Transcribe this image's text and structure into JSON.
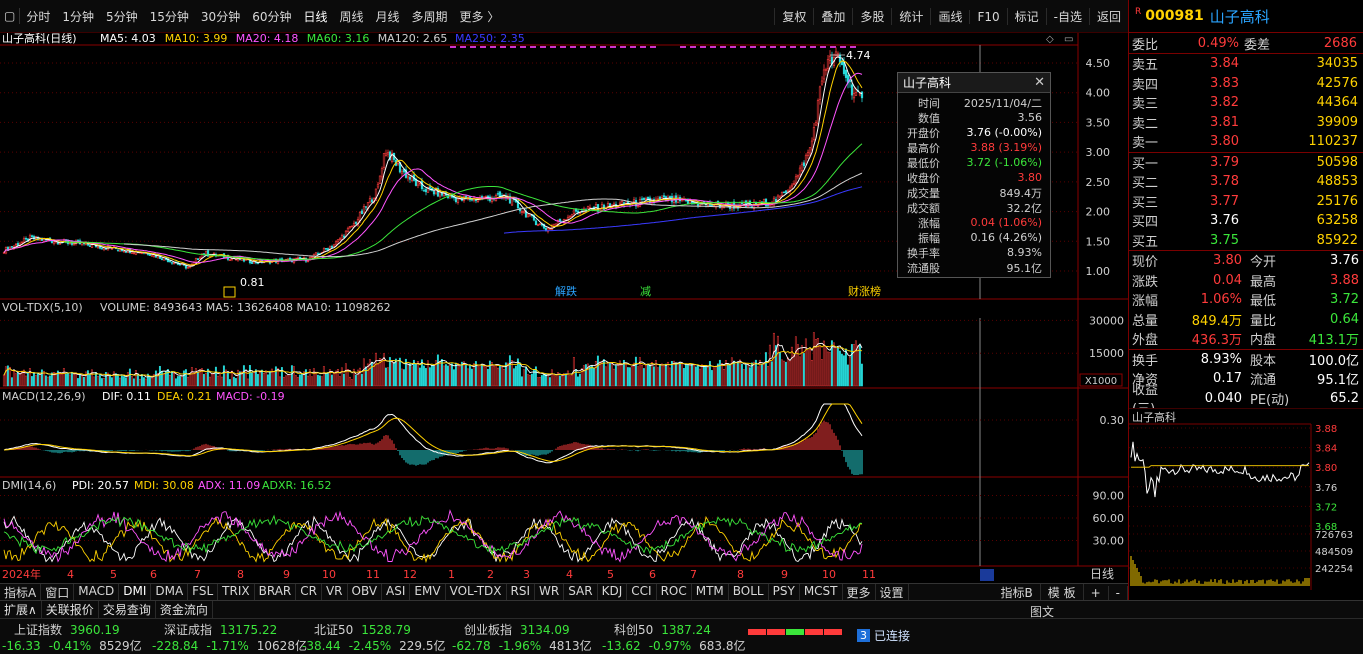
{
  "topbar": {
    "periods": [
      "分时",
      "1分钟",
      "5分钟",
      "15分钟",
      "30分钟",
      "60分钟",
      "日线",
      "周线",
      "月线",
      "多周期",
      "更多 〉"
    ],
    "active": "日线",
    "right": [
      "复权",
      "叠加",
      "多股",
      "统计",
      "画线",
      "F10",
      "标记",
      "-自选",
      "返回"
    ]
  },
  "main_chart": {
    "name": "山子高科(日线)",
    "ma": [
      {
        "label": "MA5: 4.03",
        "color": "#ffffff"
      },
      {
        "label": "MA10: 3.99",
        "color": "#ffd200"
      },
      {
        "label": "MA20: 4.18",
        "color": "#ff55ff"
      },
      {
        "label": "MA60: 3.16",
        "color": "#3be63b"
      },
      {
        "label": "MA120: 2.65",
        "color": "#d0d0d0"
      },
      {
        "label": "MA250: 2.35",
        "color": "#3a3aff"
      }
    ],
    "y_ticks": [
      "4.50",
      "4.00",
      "3.50",
      "3.00",
      "2.50",
      "2.00",
      "1.50",
      "1.00"
    ],
    "high_label": "4.74",
    "low_label": "0.81",
    "markers": [
      "解跌",
      "减",
      "财涨榜"
    ],
    "colors": {
      "up": "#ff3b3b",
      "down": "#26d9d9"
    }
  },
  "vol_panel": {
    "title": "VOL-TDX(5,10)",
    "values": "VOLUME: 8493643  MA5: 13626408  MA10: 11098262",
    "y_ticks": [
      "30000",
      "15000"
    ],
    "unit": "X1000"
  },
  "macd_panel": {
    "title": "MACD(12,26,9)",
    "dif": "DIF: 0.11",
    "dea": "DEA: 0.21",
    "macd": "MACD: -0.19",
    "y_ticks": [
      "0.30"
    ]
  },
  "dmi_panel": {
    "title": "DMI(14,6)",
    "pdi": "PDI: 20.57",
    "mdi": "MDI: 30.08",
    "adx": "ADX: 11.09",
    "adxr": "ADXR: 16.52",
    "y_ticks": [
      "90.00",
      "60.00",
      "30.00"
    ]
  },
  "x_axis": {
    "labels": [
      "2024年",
      "4",
      "5",
      "6",
      "7",
      "8",
      "9",
      "10",
      "11",
      "12",
      "1",
      "2",
      "3",
      "4",
      "5",
      "6",
      "7",
      "8",
      "9",
      "10",
      "11"
    ],
    "period_label": "日线"
  },
  "popup": {
    "title": "山子高科",
    "close": "✕",
    "rows": [
      {
        "k": "时间",
        "v": "2025/11/04/二",
        "c": "#d0d0d0"
      },
      {
        "k": "数值",
        "v": "3.56",
        "c": "#d0d0d0"
      },
      {
        "k": "开盘价",
        "v": "3.76 (-0.00%)",
        "c": "#ffffff"
      },
      {
        "k": "最高价",
        "v": "3.88 (3.19%)",
        "c": "#ff3b3b"
      },
      {
        "k": "最低价",
        "v": "3.72 (-1.06%)",
        "c": "#3be63b"
      },
      {
        "k": "收盘价",
        "v": "3.80",
        "c": "#ff3b3b"
      },
      {
        "k": "成交量",
        "v": "849.4万",
        "c": "#d0d0d0"
      },
      {
        "k": "成交额",
        "v": "32.2亿",
        "c": "#d0d0d0"
      },
      {
        "k": "涨幅",
        "v": "0.04 (1.06%)",
        "c": "#ff3b3b"
      },
      {
        "k": "振幅",
        "v": "0.16 (4.26%)",
        "c": "#d0d0d0"
      },
      {
        "k": "换手率",
        "v": "8.93%",
        "c": "#d0d0d0"
      },
      {
        "k": "流通股",
        "v": "95.1亿",
        "c": "#d0d0d0"
      }
    ]
  },
  "quote": {
    "r_flag": "R",
    "code": "000981",
    "name": "山子高科",
    "weibi_label": "委比",
    "weibi": "0.49%",
    "weicha_label": "委差",
    "weicha": "2686",
    "sells": [
      {
        "l": "卖五",
        "p": "3.84",
        "v": "34035"
      },
      {
        "l": "卖四",
        "p": "3.83",
        "v": "42576"
      },
      {
        "l": "卖三",
        "p": "3.82",
        "v": "44364"
      },
      {
        "l": "卖二",
        "p": "3.81",
        "v": "39909"
      },
      {
        "l": "卖一",
        "p": "3.80",
        "v": "110237"
      }
    ],
    "buys": [
      {
        "l": "买一",
        "p": "3.79",
        "v": "50598",
        "pc": "red"
      },
      {
        "l": "买二",
        "p": "3.78",
        "v": "48853",
        "pc": "red"
      },
      {
        "l": "买三",
        "p": "3.77",
        "v": "25176",
        "pc": "red"
      },
      {
        "l": "买四",
        "p": "3.76",
        "v": "63258",
        "pc": "wht"
      },
      {
        "l": "买五",
        "p": "3.75",
        "v": "85922",
        "pc": "grn"
      }
    ],
    "stats": [
      {
        "a": "现价",
        "b": "3.80",
        "bc": "red",
        "c": "今开",
        "d": "3.76",
        "dc": "wht"
      },
      {
        "a": "涨跌",
        "b": "0.04",
        "bc": "red",
        "c": "最高",
        "d": "3.88",
        "dc": "red"
      },
      {
        "a": "涨幅",
        "b": "1.06%",
        "bc": "red",
        "c": "最低",
        "d": "3.72",
        "dc": "grn"
      },
      {
        "a": "总量",
        "b": "849.4万",
        "bc": "yel",
        "c": "量比",
        "d": "0.64",
        "dc": "grn"
      },
      {
        "a": "外盘",
        "b": "436.3万",
        "bc": "red",
        "c": "内盘",
        "d": "413.1万",
        "dc": "grn"
      }
    ],
    "stats2": [
      {
        "a": "换手",
        "b": "8.93%",
        "c": "股本",
        "d": "100.0亿"
      },
      {
        "a": "净资",
        "b": "0.17",
        "c": "流通",
        "d": "95.1亿"
      },
      {
        "a": "收益(三)",
        "b": "0.040",
        "c": "PE(动)",
        "d": "65.2"
      }
    ],
    "mini_title": "山子高科",
    "mini_ticks": [
      "3.88",
      "3.84",
      "3.80",
      "3.76",
      "3.72",
      "3.68"
    ],
    "mini_vol_ticks": [
      "726763",
      "484509",
      "242254"
    ]
  },
  "tabs": {
    "items": [
      "指标A",
      "窗口",
      "MACD",
      "DMI",
      "DMA",
      "FSL",
      "TRIX",
      "BRAR",
      "CR",
      "VR",
      "OBV",
      "ASI",
      "EMV",
      "VOL-TDX",
      "RSI",
      "WR",
      "SAR",
      "KDJ",
      "CCI",
      "ROC",
      "MTM",
      "BOLL",
      "PSY",
      "MCST",
      "更多",
      "设置"
    ],
    "active": "DMI",
    "right": [
      "指标B",
      "模 板",
      "+",
      "-"
    ]
  },
  "tools": [
    "扩展∧",
    "关联报价",
    "交易查询",
    "资金流向"
  ],
  "status": {
    "indices": [
      {
        "name": "上证指数",
        "val": "3960.19",
        "chg": "-16.33",
        "pct": "-0.41%",
        "amt": "8529亿"
      },
      {
        "name": "深证成指",
        "val": "13175.22",
        "chg": "-228.84",
        "pct": "-1.71%",
        "amt": "10628亿"
      },
      {
        "name": "北证50",
        "val": "1528.79",
        "chg": "-38.44",
        "pct": "-2.45%",
        "amt": "229.5亿"
      },
      {
        "name": "创业板指",
        "val": "3134.09",
        "chg": "-62.78",
        "pct": "-1.96%",
        "amt": "4813亿"
      },
      {
        "name": "科创50",
        "val": "1387.24",
        "chg": "-13.62",
        "pct": "-0.97%",
        "amt": "683.8亿"
      }
    ],
    "conn_num": "3",
    "conn_text": "已连接",
    "corner": "图文"
  }
}
